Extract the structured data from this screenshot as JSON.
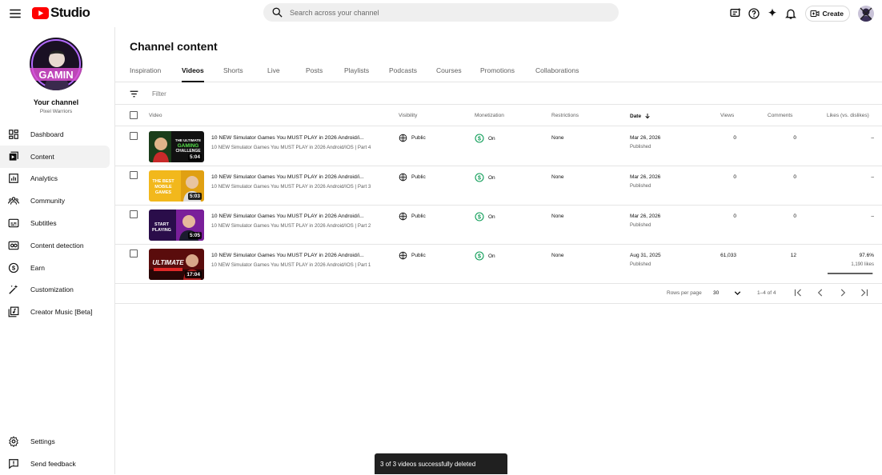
{
  "app": {
    "brand": "Studio",
    "accent": "#ff0000"
  },
  "search": {
    "placeholder": "Search across your channel"
  },
  "topbar": {
    "create_label": "Create",
    "icons": [
      "captions-icon",
      "help-icon",
      "sparkle-icon",
      "bell-icon",
      "create-video-icon"
    ]
  },
  "channel": {
    "title": "Your channel",
    "name": "Pixel Warriors",
    "avatar_text": "GAMIN"
  },
  "nav": {
    "items": [
      {
        "label": "Dashboard",
        "icon": "dashboard-icon"
      },
      {
        "label": "Content",
        "icon": "content-icon",
        "active": true
      },
      {
        "label": "Analytics",
        "icon": "analytics-icon"
      },
      {
        "label": "Community",
        "icon": "community-icon"
      },
      {
        "label": "Subtitles",
        "icon": "subtitles-icon"
      },
      {
        "label": "Content detection",
        "icon": "content-detection-icon"
      },
      {
        "label": "Earn",
        "icon": "earn-icon"
      },
      {
        "label": "Customization",
        "icon": "customization-icon"
      },
      {
        "label": "Creator Music [Beta]",
        "icon": "creator-music-icon"
      }
    ],
    "bottom": [
      {
        "label": "Settings",
        "icon": "settings-icon"
      },
      {
        "label": "Send feedback",
        "icon": "feedback-icon"
      }
    ]
  },
  "main": {
    "title": "Channel content",
    "tabs": [
      "Inspiration",
      "Videos",
      "Shorts",
      "Live",
      "Posts",
      "Playlists",
      "Podcasts",
      "Courses",
      "Promotions",
      "Collaborations"
    ],
    "active_tab": "Videos",
    "filter_placeholder": "Filter"
  },
  "table": {
    "headers": {
      "video": "Video",
      "visibility": "Visibility",
      "monetization": "Monetization",
      "restrictions": "Restrictions",
      "date": "Date",
      "views": "Views",
      "comments": "Comments",
      "likes": "Likes (vs. dislikes)"
    },
    "rows": [
      {
        "title": "10 NEW Simulator Games You MUST PLAY in 2026 Android/i...",
        "desc": "10 NEW Simulator Games You MUST PLAY in 2026 Android/IOS | Part 4",
        "duration": "5:04",
        "thumb_text": "THE ULTIMATE GAMING CHALLENGE",
        "visibility": "Public",
        "monetization": "On",
        "restrictions": "None",
        "date": "Mar 26, 2026",
        "date_status": "Published",
        "views": "0",
        "comments": "0",
        "likes": "–",
        "likes_sub": "",
        "likes_fraction": 0
      },
      {
        "title": "10 NEW Simulator Games You MUST PLAY in 2026 Android/i...",
        "desc": "10 NEW Simulator Games You MUST PLAY in 2026 Android/IOS | Part 3",
        "duration": "5:03",
        "thumb_text": "THE BEST MOBILE GAMES",
        "visibility": "Public",
        "monetization": "On",
        "restrictions": "None",
        "date": "Mar 26, 2026",
        "date_status": "Published",
        "views": "0",
        "comments": "0",
        "likes": "–",
        "likes_sub": "",
        "likes_fraction": 0
      },
      {
        "title": "10 NEW Simulator Games You MUST PLAY in 2026 Android/i...",
        "desc": "10 NEW Simulator Games You MUST PLAY in 2026 Android/IOS | Part 2",
        "duration": "5:05",
        "thumb_text": "START PLAYING",
        "visibility": "Public",
        "monetization": "On",
        "restrictions": "None",
        "date": "Mar 26, 2026",
        "date_status": "Published",
        "views": "0",
        "comments": "0",
        "likes": "–",
        "likes_sub": "",
        "likes_fraction": 0
      },
      {
        "title": "10 NEW Simulator Games You MUST PLAY in 2026 Android/i...",
        "desc": "10 NEW Simulator Games You MUST PLAY in 2026 Android/IOS | Part 1",
        "duration": "17:04",
        "thumb_text": "ULTIMATE",
        "visibility": "Public",
        "monetization": "On",
        "restrictions": "None",
        "date": "Aug 31, 2025",
        "date_status": "Published",
        "views": "61,033",
        "comments": "12",
        "likes": "97.6%",
        "likes_sub": "1,190 likes",
        "likes_fraction": 0.976
      }
    ]
  },
  "pager": {
    "rows_per_page_label": "Rows per page",
    "rows_per_page": "30",
    "range": "1–4 of 4"
  },
  "snackbar": {
    "text": "3 of 3 videos successfully deleted"
  },
  "colors": {
    "monetization_on": "#0f9d58",
    "snackbar_bg": "#202020"
  }
}
